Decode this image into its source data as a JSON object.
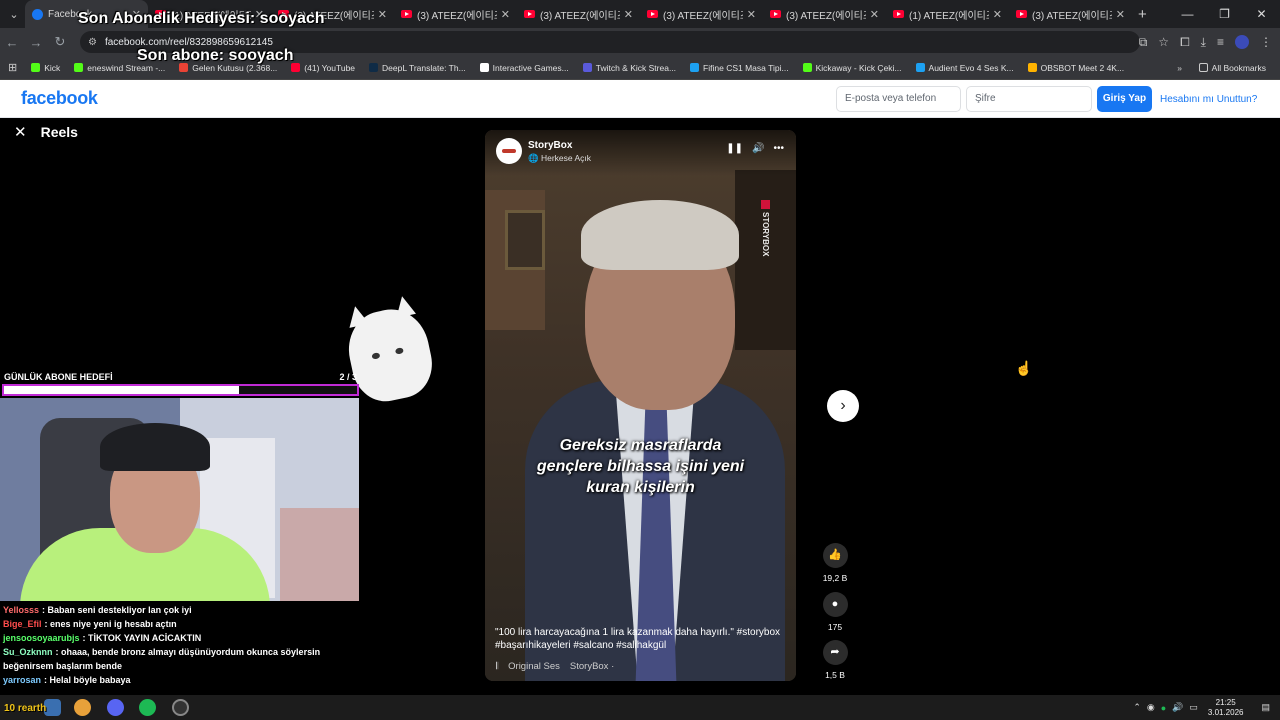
{
  "browser": {
    "tabs": [
      {
        "title": "Facebook",
        "active": true,
        "icon": "facebook-icon"
      },
      {
        "title": "(1) ATEEZ(에이티즈)",
        "icon": "youtube-icon"
      },
      {
        "title": "(3) ATEEZ(에이티즈)",
        "icon": "youtube-icon"
      },
      {
        "title": "(3) ATEEZ(에이티즈)",
        "icon": "youtube-icon"
      },
      {
        "title": "(3) ATEEZ(에이티즈)",
        "icon": "youtube-icon"
      },
      {
        "title": "(3) ATEEZ(에이티즈)",
        "icon": "youtube-icon"
      },
      {
        "title": "(3) ATEEZ(에이티즈)",
        "icon": "youtube-icon"
      },
      {
        "title": "(1) ATEEZ(에이티즈)",
        "icon": "youtube-icon"
      },
      {
        "title": "(3) ATEEZ(에이티즈)",
        "icon": "youtube-icon"
      }
    ],
    "url": "facebook.com/reel/832898659612145",
    "bookmarks": [
      {
        "label": "Kick",
        "color": "#53fc18"
      },
      {
        "label": "eneswind Stream -...",
        "color": "#53fc18"
      },
      {
        "label": "Gelen Kutusu (2.368...",
        "color": "#ea4335"
      },
      {
        "label": "(41) YouTube",
        "color": "#ff0033"
      },
      {
        "label": "DeepL Translate: Th...",
        "color": "#0f2b46"
      },
      {
        "label": "Interactive Games...",
        "color": "#ffffff"
      },
      {
        "label": "Twitch & Kick Strea...",
        "color": "#5a5adb"
      },
      {
        "label": "Fifine CS1 Masa Tipi...",
        "color": "#1da1f2"
      },
      {
        "label": "Kickaway - Kick Çeki...",
        "color": "#53fc18"
      },
      {
        "label": "Audient Evo 4 Ses K...",
        "color": "#1da1f2"
      },
      {
        "label": "OBSBOT Meet 2 4K...",
        "color": "#ffb300"
      }
    ],
    "all_bookmarks": "All Bookmarks"
  },
  "facebook": {
    "logo": "facebook",
    "email_placeholder": "E-posta veya telefon",
    "password_placeholder": "Şifre",
    "login_label": "Giriş Yap",
    "forgot_label": "Hesabını mı Unuttun?"
  },
  "reels": {
    "title": "Reels",
    "author": "StoryBox",
    "visibility": "Herkese Açık",
    "watermark": "STORYBOX",
    "subtitle_lines": [
      "Gereksiz masraflarda",
      "gençlere bilhassa işini yeni",
      "kuran kişilerin"
    ],
    "caption": "\"100 lira harcayacağına 1 lira kazanmak daha hayırlı.\" #storybox #başarıhikayeleri #salcano #salihakgül",
    "audio": [
      "Original Ses",
      "StoryBox ·"
    ],
    "likes": "19,2 B",
    "comments": "175",
    "shares": "1,5 B"
  },
  "stream_overlay": {
    "sub_gift": "Son Abonelik Hediyesi: sooyach",
    "last_sub": "Son abone: sooyach",
    "goal_label": "GÜNLÜK ABONE HEDEFİ",
    "goal_count": "2 / 3",
    "goal_progress": 0.667,
    "goal_color": "#c12bd6",
    "chat": [
      {
        "user": "Yellosss",
        "color": "#ff6b6b",
        "msg": ": Baban seni destekliyor lan çok iyi"
      },
      {
        "user": "Bige_Efil",
        "color": "#ff4d4d",
        "msg": ": enes niye yeni ig hesabı açtın"
      },
      {
        "user": "jensoosoyaarubjs",
        "color": "#58ff6a",
        "msg": ": TİKTOK YAYIN ACİCAKTIN"
      },
      {
        "user": "Su_Ozknnn",
        "color": "#8fffc2",
        "msg": ": ohaaa, bende bronz almayı düşünüyordum okunca söylersin beğenirsem başlarım bende"
      },
      {
        "user": "yarrosan",
        "color": "#7ecbff",
        "msg": ": Helal böyle babaya"
      }
    ],
    "ticker": "10 rearth"
  },
  "taskbar": {
    "time": "21:25",
    "date": "3.01.2026"
  }
}
